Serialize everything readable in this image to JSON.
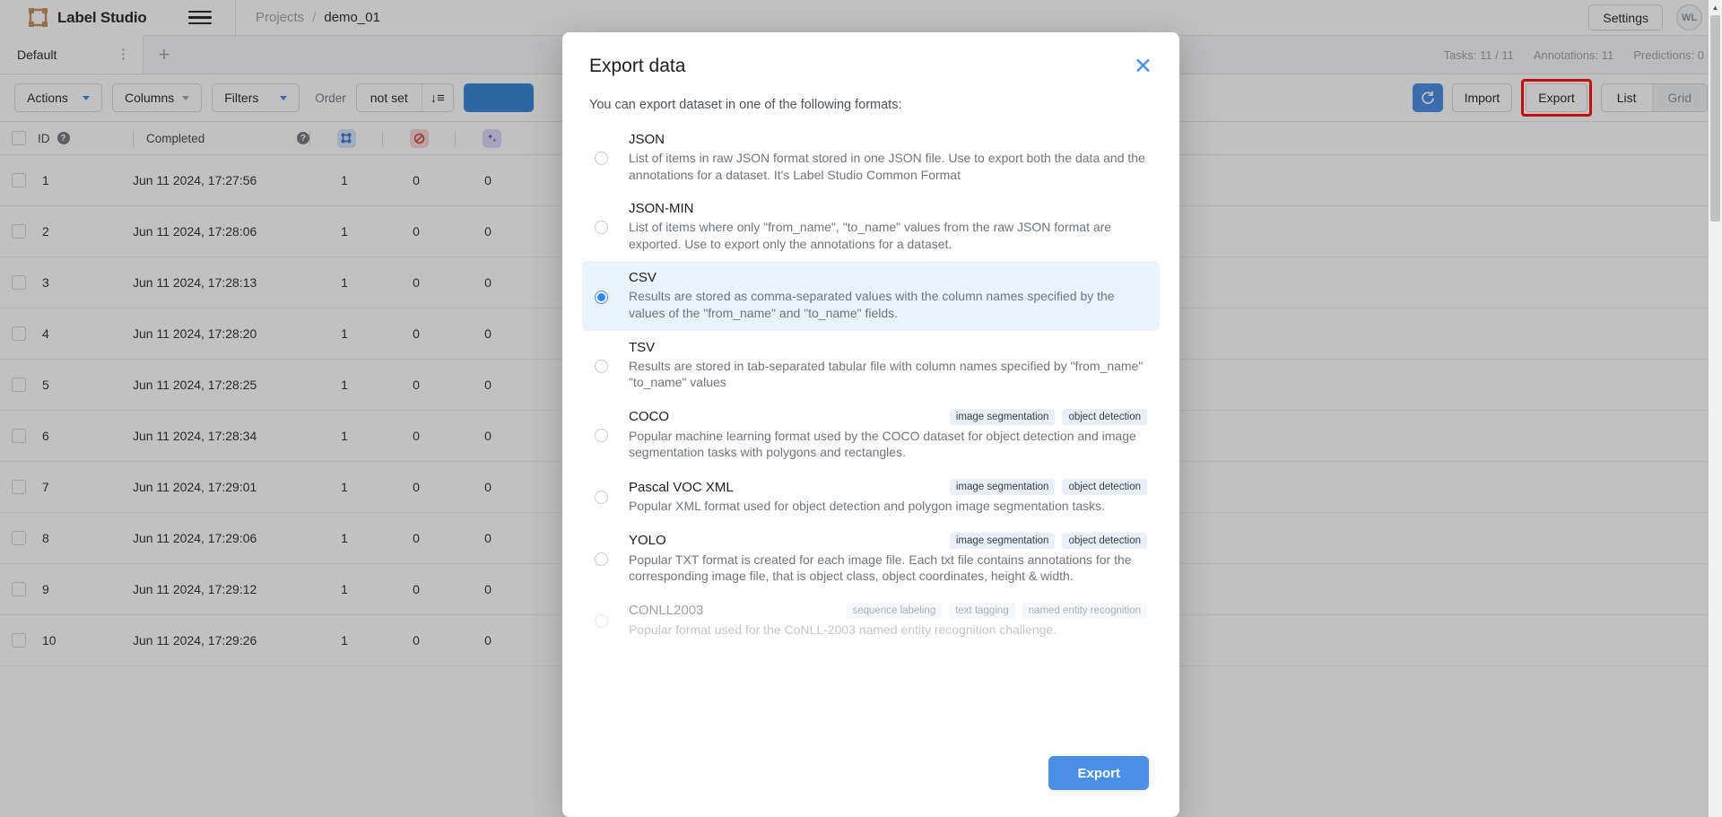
{
  "topbar": {
    "logo_icon": "label-studio-logo-icon",
    "brand": "Label Studio",
    "menu_icon": "hamburger-menu-icon",
    "breadcrumb": {
      "projects": "Projects",
      "separator": "/",
      "current": "demo_01"
    },
    "settings_label": "Settings",
    "avatar_initials": "WL"
  },
  "tabs": {
    "items": [
      {
        "label": "Default",
        "dots_icon": "more-vertical-icon"
      }
    ],
    "add_icon": "plus-icon",
    "stats": [
      "Tasks: 11 / 11",
      "Annotations: 11",
      "Predictions: 0"
    ]
  },
  "toolbar": {
    "actions_label": "Actions",
    "columns_label": "Columns",
    "filters_label": "Filters",
    "order_label": "Order",
    "order_value": "not set",
    "sort_icon": "sort-descending-icon",
    "refresh_icon": "refresh-icon",
    "import_label": "Import",
    "export_label": "Export",
    "view_list_label": "List",
    "view_grid_label": "Grid",
    "export_highlight_color": "#ff0000"
  },
  "table": {
    "columns": [
      {
        "key": "check",
        "label": "",
        "icon": "checkbox-icon"
      },
      {
        "key": "id",
        "label": "ID",
        "help_icon": "help-circle-icon"
      },
      {
        "key": "completed",
        "label": "Completed",
        "help_icon": "help-circle-icon"
      },
      {
        "key": "annotations",
        "label": "",
        "icon": "annotations-icon"
      },
      {
        "key": "cancelled",
        "label": "",
        "icon": "cancelled-icon"
      },
      {
        "key": "predictions",
        "label": "",
        "icon": "predictions-icon"
      }
    ],
    "rows": [
      {
        "id": "1",
        "completed": "Jun 11 2024, 17:27:56",
        "annotations": "1",
        "cancelled": "0",
        "predictions": "0"
      },
      {
        "id": "2",
        "completed": "Jun 11 2024, 17:28:06",
        "annotations": "1",
        "cancelled": "0",
        "predictions": "0"
      },
      {
        "id": "3",
        "completed": "Jun 11 2024, 17:28:13",
        "annotations": "1",
        "cancelled": "0",
        "predictions": "0"
      },
      {
        "id": "4",
        "completed": "Jun 11 2024, 17:28:20",
        "annotations": "1",
        "cancelled": "0",
        "predictions": "0"
      },
      {
        "id": "5",
        "completed": "Jun 11 2024, 17:28:25",
        "annotations": "1",
        "cancelled": "0",
        "predictions": "0"
      },
      {
        "id": "6",
        "completed": "Jun 11 2024, 17:28:34",
        "annotations": "1",
        "cancelled": "0",
        "predictions": "0"
      },
      {
        "id": "7",
        "completed": "Jun 11 2024, 17:29:01",
        "annotations": "1",
        "cancelled": "0",
        "predictions": "0"
      },
      {
        "id": "8",
        "completed": "Jun 11 2024, 17:29:06",
        "annotations": "1",
        "cancelled": "0",
        "predictions": "0"
      },
      {
        "id": "9",
        "completed": "Jun 11 2024, 17:29:12",
        "annotations": "1",
        "cancelled": "0",
        "predictions": "0"
      },
      {
        "id": "10",
        "completed": "Jun 11 2024, 17:29:26",
        "annotations": "1",
        "cancelled": "0",
        "predictions": "0"
      }
    ]
  },
  "modal": {
    "title": "Export data",
    "close_icon": "close-icon",
    "subtitle": "You can export dataset in one of the following formats:",
    "selected_format": "CSV",
    "accent_color": "#4a90e8",
    "selected_bg": "#eaf2fd",
    "options": [
      {
        "name": "JSON",
        "description": "List of items in raw JSON format stored in one JSON file. Use to export both the data and the annotations for a dataset. It's Label Studio Common Format",
        "tags": [],
        "selected": false,
        "disabled": false
      },
      {
        "name": "JSON-MIN",
        "description": "List of items where only \"from_name\", \"to_name\" values from the raw JSON format are exported. Use to export only the annotations for a dataset.",
        "tags": [],
        "selected": false,
        "disabled": false
      },
      {
        "name": "CSV",
        "description": "Results are stored as comma-separated values with the column names specified by the values of the \"from_name\" and \"to_name\" fields.",
        "tags": [],
        "selected": true,
        "disabled": false
      },
      {
        "name": "TSV",
        "description": "Results are stored in tab-separated tabular file with column names specified by \"from_name\" \"to_name\" values",
        "tags": [],
        "selected": false,
        "disabled": false
      },
      {
        "name": "COCO",
        "description": "Popular machine learning format used by the COCO dataset for object detection and image segmentation tasks with polygons and rectangles.",
        "tags": [
          "image segmentation",
          "object detection"
        ],
        "selected": false,
        "disabled": false
      },
      {
        "name": "Pascal VOC XML",
        "description": "Popular XML format used for object detection and polygon image segmentation tasks.",
        "tags": [
          "image segmentation",
          "object detection"
        ],
        "selected": false,
        "disabled": false
      },
      {
        "name": "YOLO",
        "description": "Popular TXT format is created for each image file. Each txt file contains annotations for the corresponding image file, that is object class, object coordinates, height & width.",
        "tags": [
          "image segmentation",
          "object detection"
        ],
        "selected": false,
        "disabled": false
      },
      {
        "name": "CONLL2003",
        "description": "Popular format used for the CoNLL-2003 named entity recognition challenge.",
        "tags": [
          "sequence labeling",
          "text tagging",
          "named entity recognition"
        ],
        "selected": false,
        "disabled": true
      }
    ],
    "export_button_label": "Export"
  },
  "scrollbar": {
    "up_arrow_icon": "chevron-up-icon"
  }
}
